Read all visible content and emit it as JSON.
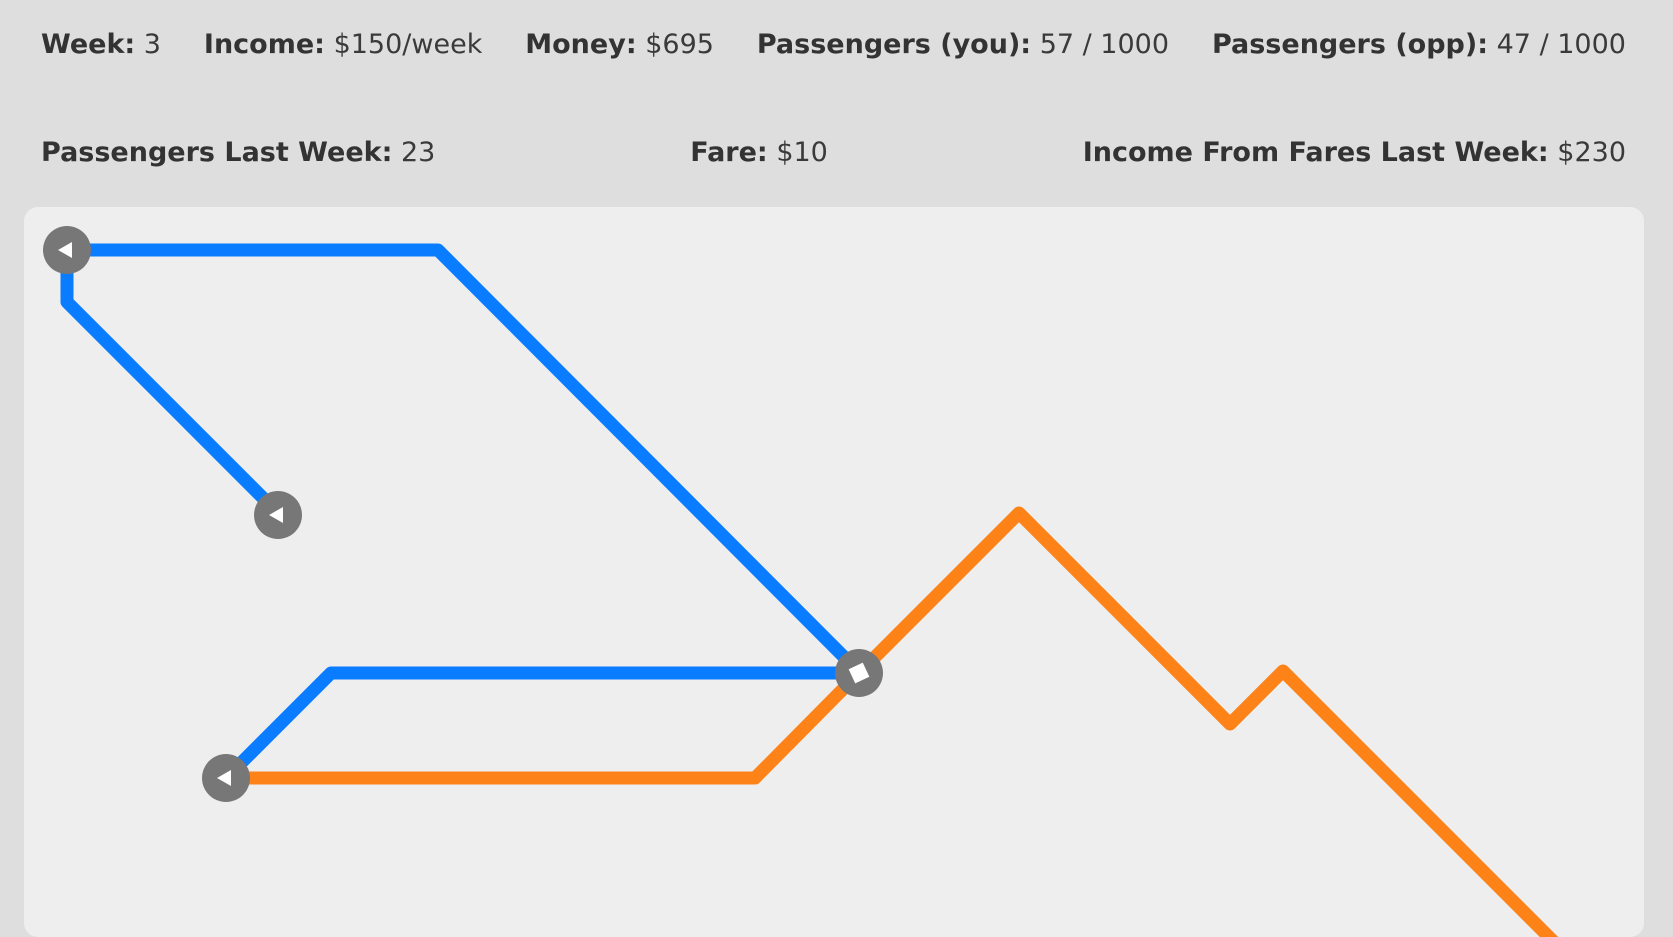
{
  "stats": {
    "week": {
      "label": "Week:",
      "value": "3"
    },
    "income": {
      "label": "Income:",
      "value": "$150/week"
    },
    "money": {
      "label": "Money:",
      "value": "$695"
    },
    "passengers_you": {
      "label": "Passengers (you):",
      "value": "57 / 1000"
    },
    "passengers_opp": {
      "label": "Passengers (opp):",
      "value": "47 / 1000"
    },
    "passengers_last_week": {
      "label": "Passengers Last Week:",
      "value": "23"
    },
    "fare": {
      "label": "Fare:",
      "value": "$10"
    },
    "income_from_fares": {
      "label": "Income From Fares Last Week:",
      "value": "$230"
    }
  },
  "map": {
    "colors": {
      "player_line": "#0a7cff",
      "opponent_line": "#fd8319",
      "station": "#777777",
      "station_icon": "#ffffff",
      "board_bg": "#eeeeee"
    },
    "stations": [
      {
        "name": "station-top-left",
        "icon": "triangle-icon"
      },
      {
        "name": "station-upper-middle",
        "icon": "triangle-icon"
      },
      {
        "name": "station-hub",
        "icon": "diamond-icon"
      },
      {
        "name": "station-lower-left",
        "icon": "triangle-icon"
      }
    ]
  }
}
